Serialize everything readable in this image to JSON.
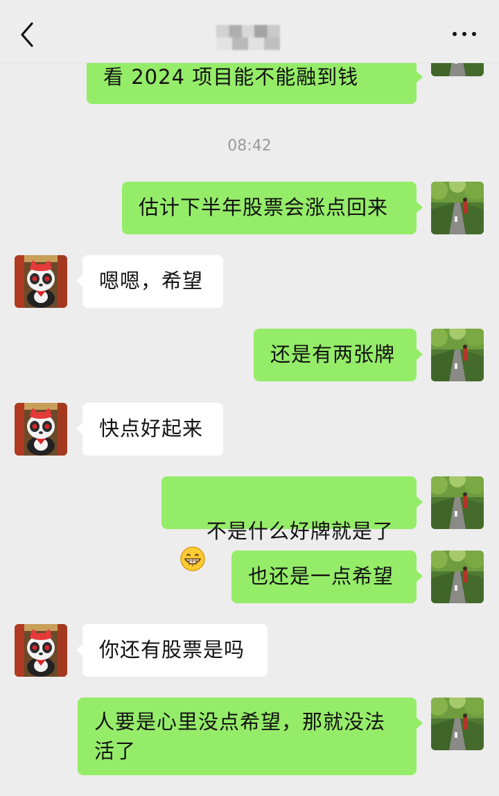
{
  "header": {
    "title": "",
    "back_icon": "chevron-left-icon",
    "more_icon": "ellipsis-icon"
  },
  "timestamp": "08:42",
  "messages": [
    {
      "side": "out",
      "text": "看 2024 项目能不能融到钱"
    },
    {
      "side": "out",
      "text": "估计下半年股票会涨点回来"
    },
    {
      "side": "in",
      "text": "嗯嗯，希望"
    },
    {
      "side": "out",
      "text": "还是有两张牌"
    },
    {
      "side": "in",
      "text": "快点好起来"
    },
    {
      "side": "out",
      "text": "不是什么好牌就是了",
      "emoji": "grinning-face-icon"
    },
    {
      "side": "out",
      "text": "也还是一点希望"
    },
    {
      "side": "in",
      "text": "你还有股票是吗"
    },
    {
      "side": "out",
      "text": "人要是心里没点希望，那就没法\n活了"
    }
  ],
  "colors": {
    "background": "#ededed",
    "outgoing_bubble": "#95ec69",
    "incoming_bubble": "#ffffff",
    "timestamp": "#9a9a9a"
  }
}
